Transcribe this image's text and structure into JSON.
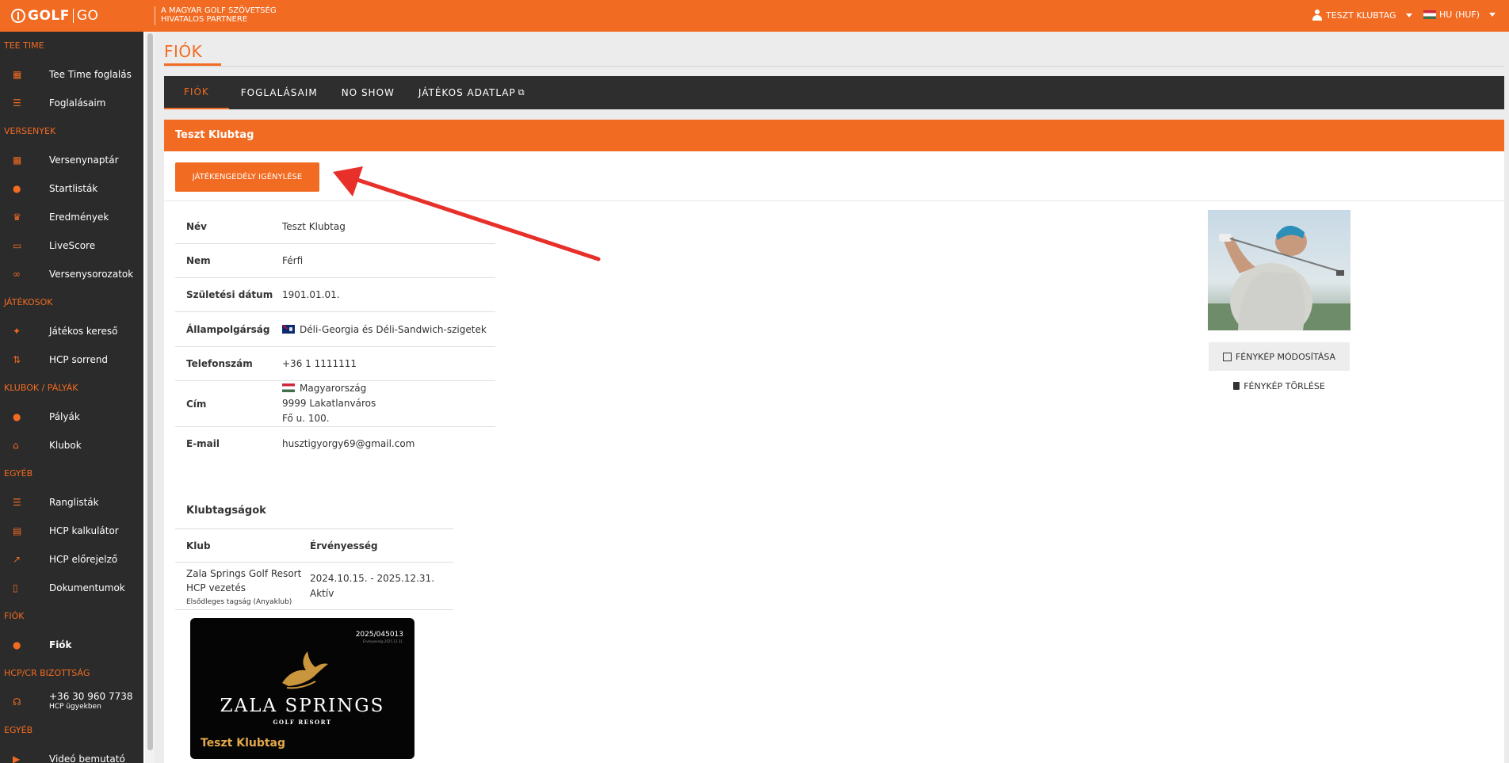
{
  "topbar": {
    "logo_golf": "GOLF",
    "logo_go": "GO",
    "partner_line1": "A MAGYAR GOLF SZÖVETSÉG",
    "partner_line2": "HIVATALOS PARTNERE",
    "user": "TESZT KLUBTAG",
    "lang": "HU (HUF)"
  },
  "sidebar": {
    "sections": [
      {
        "title": "TEE TIME",
        "items": [
          {
            "label": "Tee Time foglalás",
            "icon": "calendar-icon"
          },
          {
            "label": "Foglalásaim",
            "icon": "list-icon"
          }
        ]
      },
      {
        "title": "VERSENYEK",
        "items": [
          {
            "label": "Versenynaptár",
            "icon": "calendar-icon"
          },
          {
            "label": "Startlisták",
            "icon": "map-pin-icon"
          },
          {
            "label": "Eredmények",
            "icon": "trophy-icon"
          },
          {
            "label": "LiveScore",
            "icon": "cast-icon"
          },
          {
            "label": "Versenysorozatok",
            "icon": "link-icon"
          }
        ]
      },
      {
        "title": "JÁTÉKOSOK",
        "items": [
          {
            "label": "Játékos kereső",
            "icon": "running-icon"
          },
          {
            "label": "HCP sorrend",
            "icon": "sort-icon"
          }
        ]
      },
      {
        "title": "KLUBOK / PÁLYÁK",
        "items": [
          {
            "label": "Pályák",
            "icon": "map-pin-icon"
          },
          {
            "label": "Klubok",
            "icon": "bank-icon"
          }
        ]
      },
      {
        "title": "EGYÉB",
        "items": [
          {
            "label": "Ranglisták",
            "icon": "list-icon"
          },
          {
            "label": "HCP kalkulátor",
            "icon": "calculator-icon"
          },
          {
            "label": "HCP előrejelző",
            "icon": "chart-icon"
          },
          {
            "label": "Dokumentumok",
            "icon": "document-icon"
          }
        ]
      },
      {
        "title": "FIÓK",
        "items": [
          {
            "label": "Fiók",
            "icon": "user-icon"
          }
        ]
      },
      {
        "title": "HCP/CR BIZOTTSÁG",
        "items": [
          {
            "label": "+36 30 960 7738",
            "sub": "HCP ügyekben",
            "icon": "headset-icon"
          }
        ]
      },
      {
        "title": "EGYÉB",
        "items": [
          {
            "label": "Videó bemutató",
            "icon": "video-icon"
          }
        ]
      }
    ]
  },
  "page": {
    "title": "FIÓK"
  },
  "tabs": [
    "FIÓK",
    "FOGLALÁSAIM",
    "NO SHOW",
    "JÁTÉKOS ADATLAP"
  ],
  "panel": {
    "header": "Teszt Klubtag",
    "request_button": "JÁTÉKENGEDÉLY IGÉNYLÉSE"
  },
  "profile": {
    "name_label": "Név",
    "name": "Teszt Klubtag",
    "gender_label": "Nem",
    "gender": "Férfi",
    "birth_label": "Születési dátum",
    "birth": "1901.01.01.",
    "citizenship_label": "Állampolgárság",
    "citizenship": "Déli-Georgia és Déli-Sandwich-szigetek",
    "phone_label": "Telefonszám",
    "phone": "+36 1 1111111",
    "address_label": "Cím",
    "address_country": "Magyarország",
    "address_city": "9999 Lakatlanváros",
    "address_street": "Fő u. 100.",
    "email_label": "E-mail",
    "email": "husztigyorgy69@gmail.com"
  },
  "photo": {
    "edit_button": "FÉNYKÉP MÓDOSÍTÁSA",
    "delete_button": "FÉNYKÉP TÖRLÉSE"
  },
  "memberships": {
    "title": "Klubtagságok",
    "col_club": "Klub",
    "col_validity": "Érvényesség",
    "rows": [
      {
        "club_line1": "Zala Springs Golf Resort",
        "club_line2": "HCP vezetés",
        "note": "Elsődleges tagság (Anyaklub)",
        "validity": "2024.10.15. - 2025.12.31.",
        "status": "Aktív"
      }
    ]
  },
  "card": {
    "id": "2025/045013",
    "sub_id": "Érvényesség 2025.12.31.",
    "brand": "ZALA SPRINGS",
    "subtitle": "GOLF RESORT",
    "holder": "Teszt Klubtag"
  },
  "colors": {
    "accent": "#f26b22",
    "sidebar": "#2b2b2b",
    "tabs": "#2e2e2e",
    "annotation_arrow": "#e8302a"
  }
}
